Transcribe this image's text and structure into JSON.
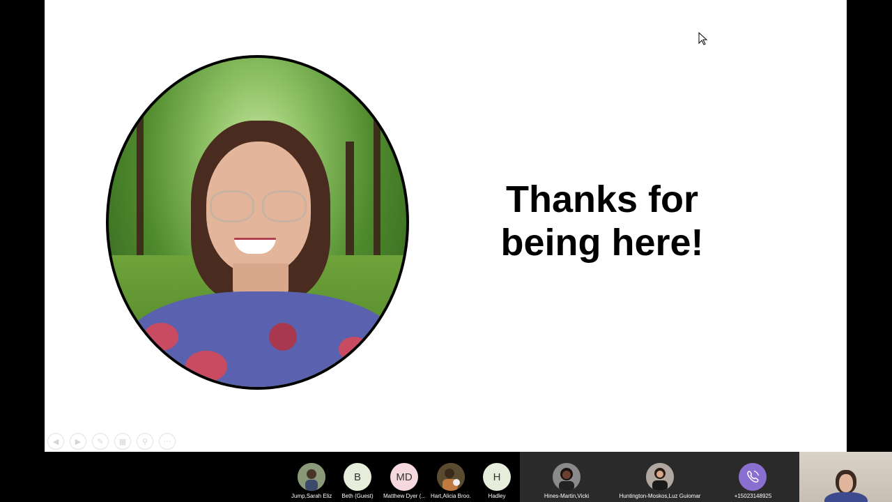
{
  "slide": {
    "heading_line1": "Thanks for",
    "heading_line2": "being here!",
    "controls": [
      "previous-icon",
      "next-icon",
      "pen-icon",
      "slides-icon",
      "zoom-icon",
      "more-icon"
    ]
  },
  "participants": [
    {
      "name": "Jump,Sarah Eliz...",
      "initials": "",
      "avatar": "photo",
      "color": "#7a8a6a"
    },
    {
      "name": "Beth (Guest)",
      "initials": "B",
      "avatar": "initials",
      "color": "#e6eedb"
    },
    {
      "name": "Matthew Dyer (...",
      "initials": "MD",
      "avatar": "initials",
      "color": "#f6d9df"
    },
    {
      "name": "Hart,Alicia Broo...",
      "initials": "",
      "avatar": "photo",
      "color": "#6b5a3a"
    },
    {
      "name": "Hadley",
      "initials": "H",
      "avatar": "initials",
      "color": "#e6eedb"
    },
    {
      "name": "Hines-Martin,Vicki",
      "initials": "",
      "avatar": "photo",
      "color": "#4a3a30"
    },
    {
      "name": "Huntington-Moskos,Luz Guiomar",
      "initials": "",
      "avatar": "photo",
      "color": "#6a5a52"
    },
    {
      "name": "+15023148925",
      "initials": "",
      "avatar": "phone-icon",
      "color": "#8a6fd1"
    }
  ],
  "colors": {
    "slide_bg": "#ffffff",
    "bar_bg": "#000000",
    "dark_tile": "#2a2a2a",
    "phone_avatar": "#8a6fd1"
  }
}
